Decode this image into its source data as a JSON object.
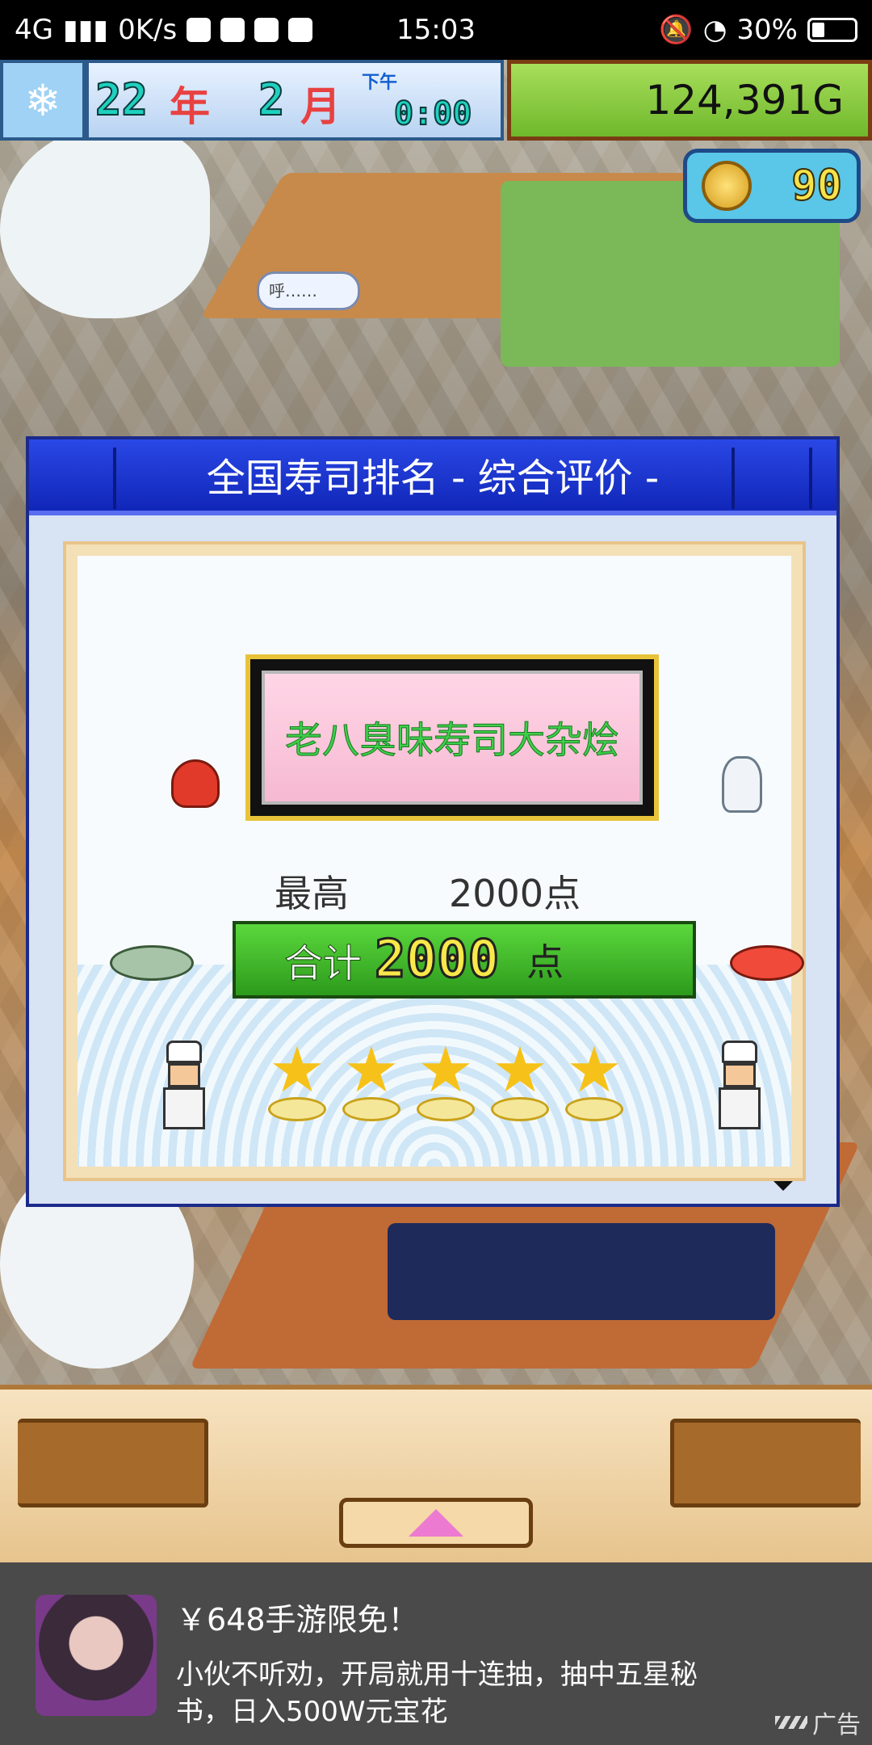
{
  "status_bar": {
    "network": "4G",
    "speed": "0K/s",
    "time": "15:03",
    "battery": "30%"
  },
  "hud": {
    "year": "22",
    "year_unit": "年",
    "month": "2",
    "month_unit": "月",
    "ampm": "下午",
    "clock": "0:00",
    "money": "124,391G",
    "coins": "90"
  },
  "speech_bubble": "呼……",
  "modal": {
    "title": "全国寿司排名 - 综合评价 -",
    "shop_name": "老八臭味寿司大杂烩",
    "best_label": "最高",
    "best_value": "2000点",
    "total_label": "合计",
    "total_value": "2000",
    "total_unit": "点",
    "rating_stars": 5
  },
  "ad": {
    "title": "￥648手游限免！",
    "description": "小伙不听劝，开局就用十连抽，抽中五星秘书，日入500W元宝花",
    "tag": "广告"
  }
}
